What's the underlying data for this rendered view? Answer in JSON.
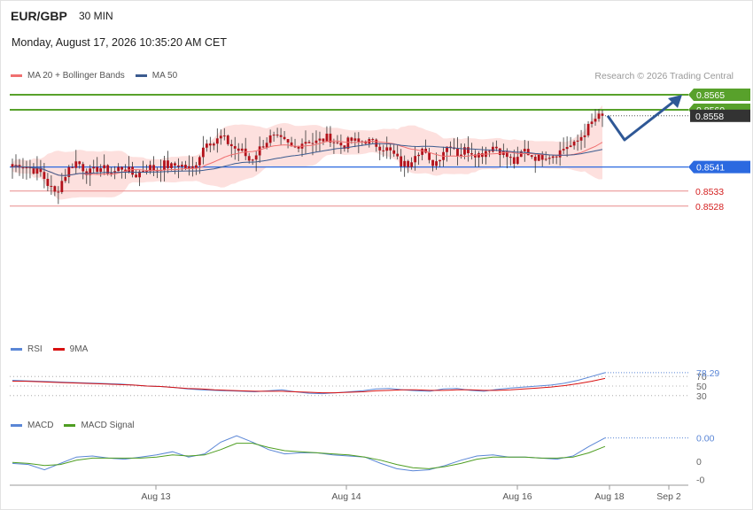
{
  "header": {
    "symbol": "EUR/GBP",
    "timeframe": "30 MIN",
    "datetime": "Monday, August 17, 2026 10:35:20 AM CET",
    "credit": "Research © 2026 Trading Central"
  },
  "colors": {
    "ma20": "#f07070",
    "bollinger_fill": "#fde0de",
    "ma50": "#3b5b8f",
    "resistance": "#58a12b",
    "support": "#2b69e0",
    "minor_level": "#e88a8a",
    "minor_label": "#d42020",
    "last_price": "#333333",
    "candle": "#b3121b",
    "rsi": "#5a86d6",
    "rsi_ma": "#d81010",
    "macd": "#5a86d6",
    "macd_signal": "#4f9e22",
    "forecast_arrow": "#2f5896"
  },
  "legends": {
    "main": [
      {
        "label": "MA 20 + Bollinger Bands",
        "color": "#f07070"
      },
      {
        "label": "MA 50",
        "color": "#3b5b8f"
      }
    ],
    "rsi": [
      {
        "label": "RSI",
        "color": "#5a86d6"
      },
      {
        "label": "9MA",
        "color": "#d81010"
      }
    ],
    "macd": [
      {
        "label": "MACD",
        "color": "#5a86d6"
      },
      {
        "label": "MACD Signal",
        "color": "#4f9e22"
      }
    ]
  },
  "chart_data": [
    {
      "type": "candlestick",
      "panel": "price",
      "y_range": [
        0.8524,
        0.857
      ],
      "x_ticks": [
        "Aug 13",
        "Aug 14",
        "Aug 16",
        "Aug 18",
        "Sep 2"
      ],
      "overlays": [
        "MA 20 + Bollinger Bands",
        "MA 50"
      ],
      "levels": [
        {
          "value": 0.8565,
          "label": "0.8565",
          "kind": "resistance"
        },
        {
          "value": 0.856,
          "label": "0.8560",
          "kind": "resistance"
        },
        {
          "value": 0.8558,
          "label": "0.8558",
          "kind": "last_price"
        },
        {
          "value": 0.8541,
          "label": "0.8541",
          "kind": "support"
        },
        {
          "value": 0.8533,
          "label": "0.8533",
          "kind": "minor"
        },
        {
          "value": 0.8528,
          "label": "0.8528",
          "kind": "minor"
        }
      ],
      "close_path": [
        0.8541,
        0.8542,
        0.8541,
        0.854,
        0.8539,
        0.8535,
        0.8532,
        0.8537,
        0.8541,
        0.8543,
        0.854,
        0.8539,
        0.8541,
        0.854,
        0.8539,
        0.8541,
        0.854,
        0.8538,
        0.854,
        0.8541,
        0.854,
        0.8542,
        0.8541,
        0.8542,
        0.8541,
        0.854,
        0.8545,
        0.855,
        0.8549,
        0.8551,
        0.8549,
        0.8547,
        0.8546,
        0.8543,
        0.8546,
        0.8549,
        0.8551,
        0.855,
        0.8549,
        0.8547,
        0.8549,
        0.855,
        0.8549,
        0.855,
        0.8551,
        0.8549,
        0.8548,
        0.855,
        0.8549,
        0.855,
        0.8549,
        0.8548,
        0.8547,
        0.8545,
        0.8542,
        0.8542,
        0.8546,
        0.8547,
        0.8542,
        0.8543,
        0.8547,
        0.8549,
        0.8545,
        0.8547,
        0.8546,
        0.8545,
        0.8547,
        0.8548,
        0.8546,
        0.8544,
        0.8542,
        0.8547,
        0.8545,
        0.8544,
        0.8545,
        0.8545,
        0.8546,
        0.8548,
        0.8548,
        0.8551,
        0.8554,
        0.8557,
        0.8558
      ],
      "forecast": {
        "from": 0.8558,
        "via": 0.855,
        "to": 0.8565
      }
    },
    {
      "type": "line",
      "panel": "rsi",
      "value_label": "78.29",
      "ticks": [
        "70",
        "50",
        "30"
      ],
      "series": [
        {
          "name": "RSI",
          "values": [
            62,
            61,
            60,
            59,
            58,
            57,
            56,
            55,
            54,
            52,
            50,
            49,
            47,
            44,
            42,
            41,
            40,
            39,
            38,
            40,
            42,
            38,
            35,
            34,
            36,
            38,
            40,
            44,
            45,
            42,
            40,
            39,
            44,
            45,
            41,
            39,
            43,
            46,
            48,
            50,
            52,
            56,
            62,
            70,
            78
          ]
        },
        {
          "name": "9MA",
          "values": [
            60,
            60,
            59,
            58,
            57,
            56,
            55,
            54,
            53,
            52,
            50,
            49,
            47,
            45,
            44,
            42,
            41,
            40,
            39,
            39,
            39,
            38,
            37,
            36,
            36,
            37,
            38,
            40,
            41,
            42,
            42,
            41,
            41,
            42,
            42,
            41,
            41,
            42,
            44,
            46,
            48,
            51,
            55,
            60,
            66
          ]
        }
      ]
    },
    {
      "type": "line",
      "panel": "macd",
      "value_label": "0.00",
      "ticks": [
        "0",
        "0",
        "-0"
      ],
      "series": [
        {
          "name": "MACD",
          "values": [
            -0.2,
            -0.3,
            -0.8,
            -0.2,
            0.4,
            0.5,
            0.3,
            0.2,
            0.4,
            0.6,
            0.9,
            0.4,
            0.7,
            1.8,
            2.4,
            1.8,
            1.1,
            0.7,
            0.8,
            0.8,
            0.6,
            0.5,
            0.4,
            -0.2,
            -0.7,
            -0.9,
            -0.8,
            -0.4,
            0.1,
            0.5,
            0.6,
            0.4,
            0.4,
            0.3,
            0.2,
            0.5,
            1.4,
            2.2
          ]
        },
        {
          "name": "MACD Signal",
          "values": [
            -0.1,
            -0.2,
            -0.4,
            -0.3,
            0.1,
            0.3,
            0.3,
            0.3,
            0.3,
            0.4,
            0.6,
            0.5,
            0.6,
            1.1,
            1.7,
            1.7,
            1.3,
            1.0,
            0.9,
            0.8,
            0.7,
            0.6,
            0.4,
            0.1,
            -0.3,
            -0.6,
            -0.7,
            -0.5,
            -0.2,
            0.2,
            0.4,
            0.4,
            0.4,
            0.3,
            0.3,
            0.4,
            0.8,
            1.4
          ]
        }
      ]
    }
  ]
}
